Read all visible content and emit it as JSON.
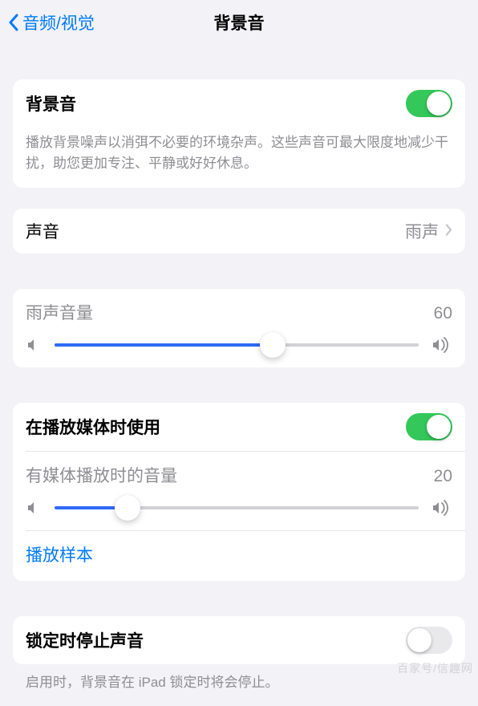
{
  "nav": {
    "back_label": "音频/视觉",
    "title": "背景音"
  },
  "main_toggle": {
    "label": "背景音",
    "on": true,
    "description": "播放背景噪声以消弭不必要的环境杂声。这些声音可最大限度地减少干扰，助您更加专注、平静或好好休息。"
  },
  "sound_row": {
    "label": "声音",
    "value": "雨声"
  },
  "volume_block": {
    "title": "雨声音量",
    "value": 60
  },
  "media_block": {
    "use_label": "在播放媒体时使用",
    "use_on": true,
    "media_vol_title": "有媒体播放时的音量",
    "media_vol_value": 20,
    "sample_link": "播放样本"
  },
  "lock_block": {
    "label": "锁定时停止声音",
    "on": false,
    "description": "启用时，背景音在 iPad 锁定时将会停止。"
  },
  "watermark": "百家号/信趣网"
}
